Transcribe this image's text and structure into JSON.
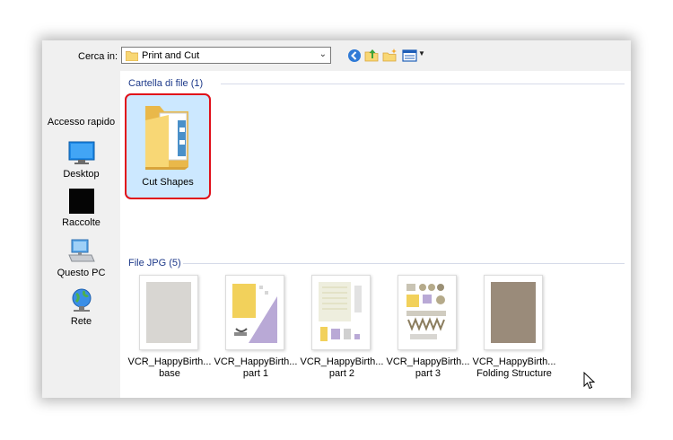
{
  "toolbar": {
    "look_in_label": "Cerca in:",
    "location": "Print and Cut",
    "icons": [
      "back-icon",
      "up-folder-icon",
      "new-folder-icon",
      "view-menu-icon"
    ]
  },
  "places": [
    {
      "label": "Accesso rapido",
      "icon": "quick-access"
    },
    {
      "label": "Desktop",
      "icon": "desktop-icon"
    },
    {
      "label": "Raccolte",
      "icon": "libraries-icon"
    },
    {
      "label": "Questo PC",
      "icon": "this-pc-icon"
    },
    {
      "label": "Rete",
      "icon": "network-icon"
    }
  ],
  "groups": {
    "folders": {
      "header": "Cartella di file (1)",
      "items": [
        {
          "name": "Cut Shapes",
          "selected": true
        }
      ]
    },
    "jpg": {
      "header": "File JPG (5)",
      "items": [
        {
          "line1": "VCR_HappyBirth...",
          "line2": "base"
        },
        {
          "line1": "VCR_HappyBirth...",
          "line2": "part 1"
        },
        {
          "line1": "VCR_HappyBirth...",
          "line2": "part 2"
        },
        {
          "line1": "VCR_HappyBirth...",
          "line2": "part 3"
        },
        {
          "line1": "VCR_HappyBirth...",
          "line2": "Folding Structure"
        }
      ]
    }
  },
  "colors": {
    "accent_blue": "#1e3a8a",
    "selection": "#cce8ff",
    "highlight_red": "#e0101a",
    "folder_yellow": "#f8d775"
  }
}
